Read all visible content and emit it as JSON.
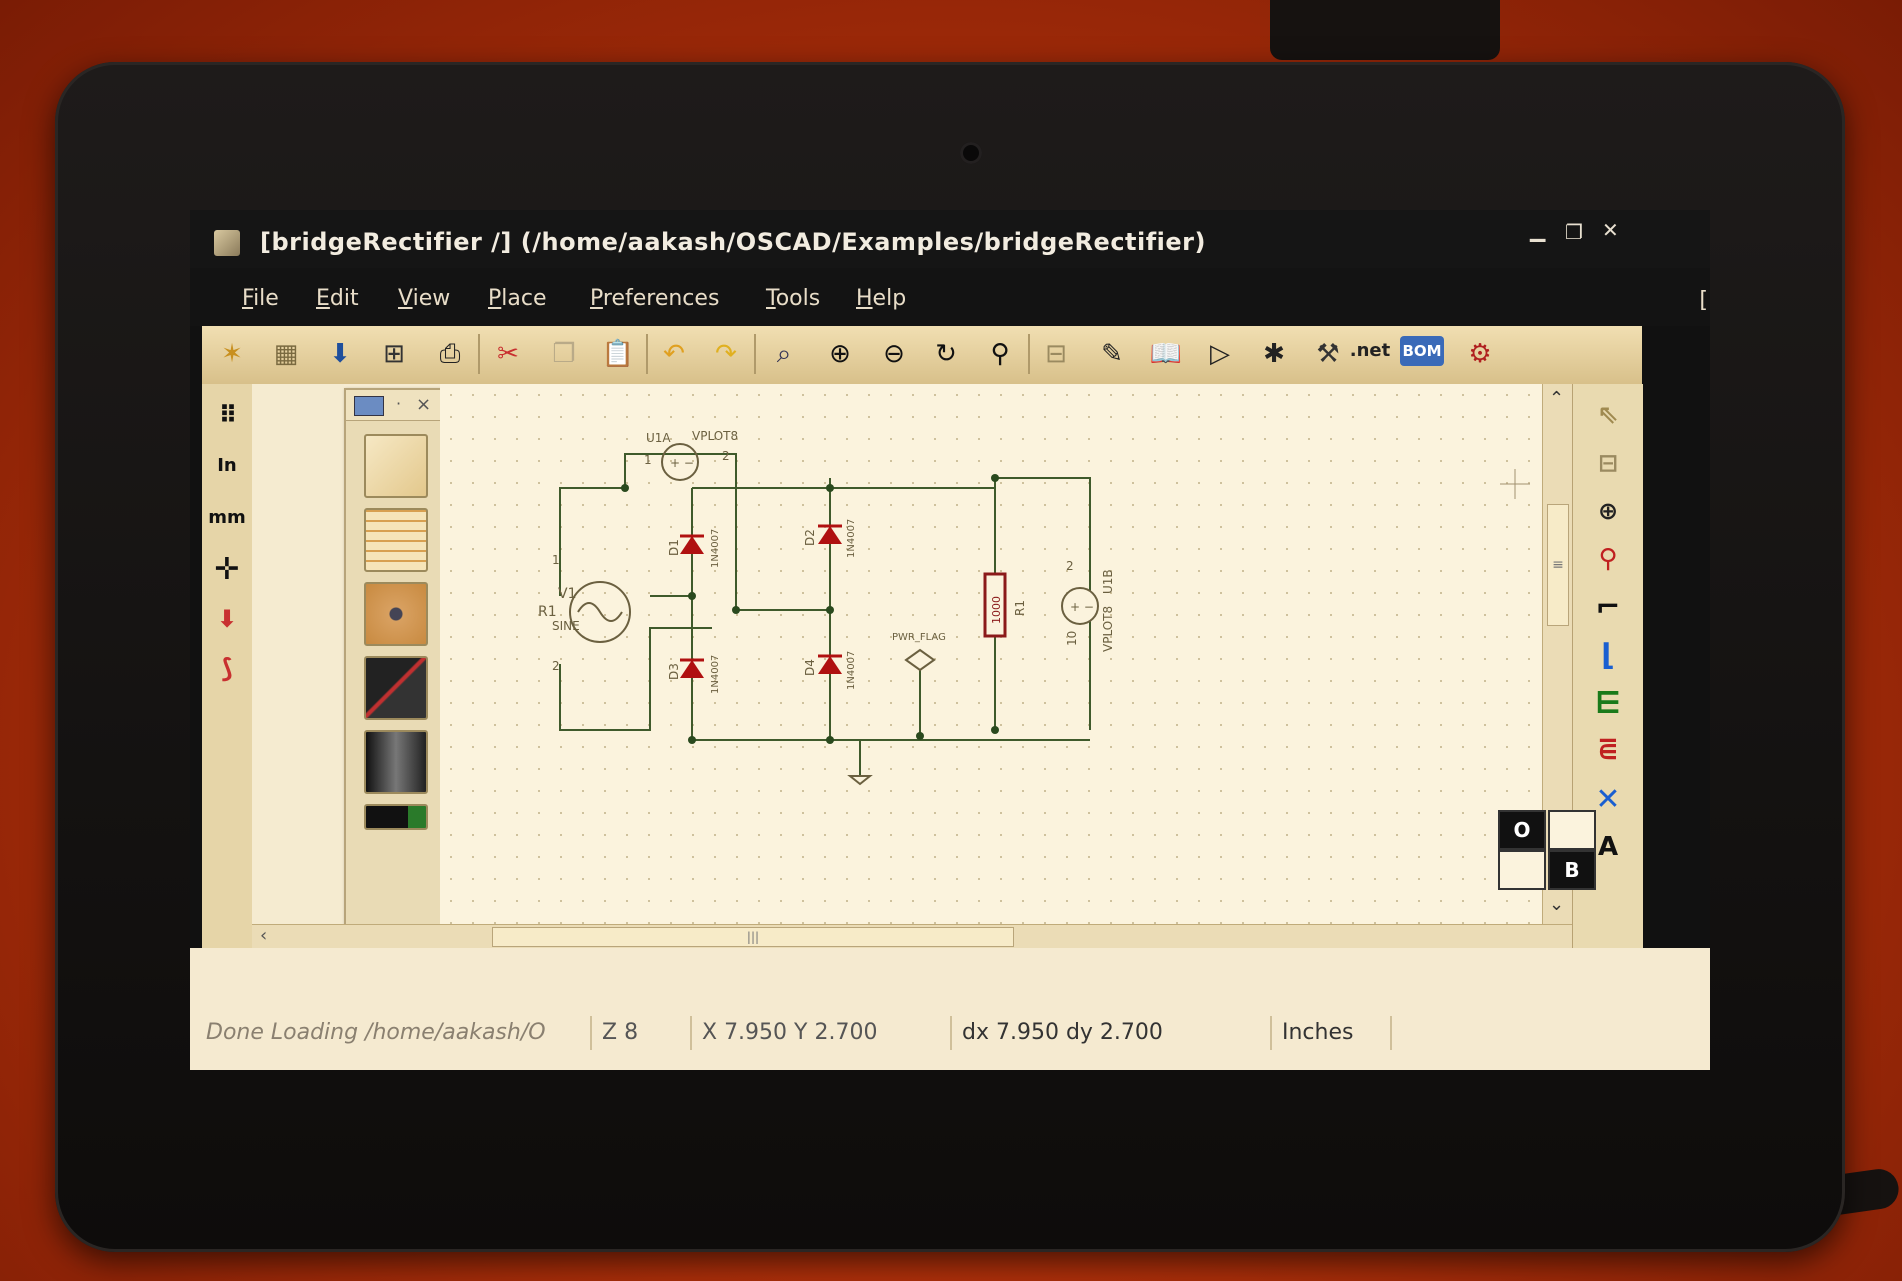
{
  "window": {
    "title": "[bridgeRectifier /] (/home/aakash/OSCAD/Examples/bridgeRectifier)",
    "minimize_glyph": "▁",
    "restore_glyph": "❐",
    "close_glyph": "✕"
  },
  "menu": {
    "items": [
      "File",
      "Edit",
      "View",
      "Place",
      "Preferences",
      "Tools",
      "Help"
    ],
    "overflow": "["
  },
  "toolbar": {
    "icons": [
      "new-schematic-icon",
      "new-sheet-icon",
      "save-icon",
      "page-settings-icon",
      "print-icon",
      "cut-icon",
      "copy-icon",
      "paste-icon",
      "undo-icon",
      "redo-icon",
      "find-icon",
      "zoom-in-icon",
      "zoom-out-icon",
      "redraw-icon",
      "zoom-fit-icon",
      "hierarchy-icon",
      "library-editor-icon",
      "library-browser-icon",
      "annotate-icon",
      "erc-icon",
      "netlist-icon",
      "net-label",
      "bom-label",
      "pcb-icon"
    ],
    "net_label": ".net",
    "bom_label": "BOM"
  },
  "left_tools": {
    "inch_label": "In",
    "mm_label": "mm"
  },
  "schematic": {
    "labels": {
      "u1a": "U1A",
      "vplot8_top": "VPLOT8",
      "pin1_top": "1",
      "pin2_top": "2",
      "v1": "V1",
      "r1_src": "R1",
      "sine": "SINE",
      "d1": "D1",
      "d2": "D2",
      "d3": "D3",
      "d4": "D4",
      "d1_part": "1N4007",
      "d2_part": "1N4007",
      "d3_part": "1N4007",
      "d4_part": "1N4007",
      "r1_res": "R1",
      "r1_value": "1000",
      "u1b": "U1B",
      "vplot8_right": "VPLOT8",
      "pwr_flag": "PWR_FLAG",
      "src_pin1": "1",
      "src_pin2": "2",
      "u1b_pin2": "2",
      "u1b_pin10": "10"
    }
  },
  "mode_boxes": {
    "o_label": "O",
    "b_label": "B"
  },
  "status": {
    "message": "Done Loading /home/aakash/O",
    "zoom": "Z 8",
    "cursor": "X 7.950  Y 2.700",
    "delta": "dx 7.950  dy 2.700",
    "units": "Inches"
  },
  "colors": {
    "wire": "#3f5a2b",
    "diode": "#b01010",
    "resistor": "#8b1a1a",
    "toolbar": "#e6d09c"
  }
}
